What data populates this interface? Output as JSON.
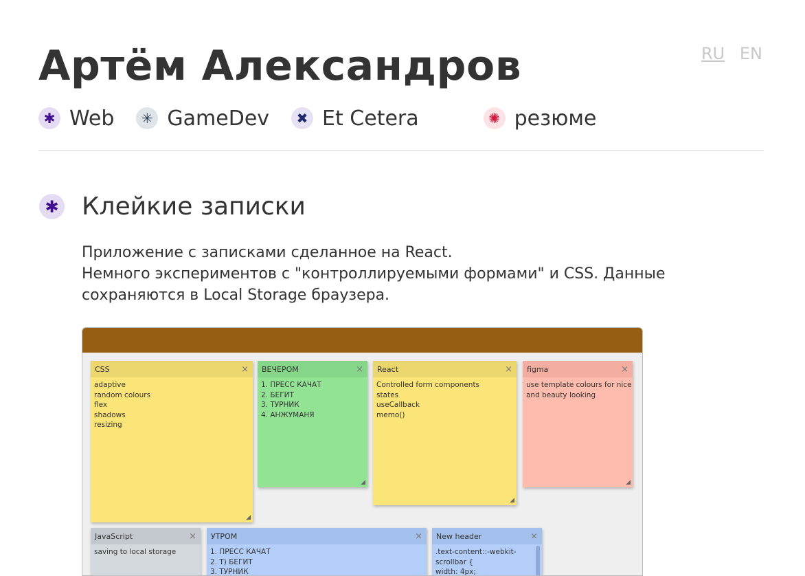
{
  "header": {
    "title": "Артём Александров",
    "lang": {
      "ru": "RU",
      "en": "EN"
    }
  },
  "nav": {
    "web": "Web",
    "gamedev": "GameDev",
    "etc": "Et Cetera",
    "resume": "резюме"
  },
  "section": {
    "title": "Клейкие записки",
    "desc_line1": "Приложение с записками сделанное на React.",
    "desc_line2": "Немного экспериментов с \"контроллируемыми формами\" и CSS. Данные сохраняются в Local Storage браузера."
  },
  "notes": [
    {
      "title": "CSS",
      "lines": [
        "adaptive",
        "random colours",
        "flex",
        "shadows",
        "resizing"
      ]
    },
    {
      "title": "ВЕЧЕРОМ",
      "lines": [
        "1. ПРЕСС КАЧАТ",
        "2. БЕГИТ",
        "3. ТУРНИК",
        "4. АНЖУМАНЯ"
      ]
    },
    {
      "title": "React",
      "lines": [
        "Controlled form components",
        "states",
        "useCallback",
        "memo()"
      ]
    },
    {
      "title": "figma",
      "lines": [
        "use template colours for nice",
        "and beauty looking"
      ]
    },
    {
      "title": "JavaScript",
      "lines": [
        "saving to local storage"
      ]
    },
    {
      "title": "УТРОМ",
      "lines": [
        "1. ПРЕСС КАЧАТ",
        "2. Т) БЕГИТ",
        "3. ТУРНИК"
      ]
    },
    {
      "title": "New header",
      "lines": [
        ".text-content::-webkit-",
        "scrollbar {",
        "width: 4px;"
      ]
    }
  ],
  "close_glyph": "×",
  "colors": {
    "app_bar": "#955e12",
    "yellow": "#fbe478",
    "green": "#92e394",
    "pink": "#fdbcad",
    "grey": "#d4d9de",
    "blue": "#b3cff9"
  }
}
